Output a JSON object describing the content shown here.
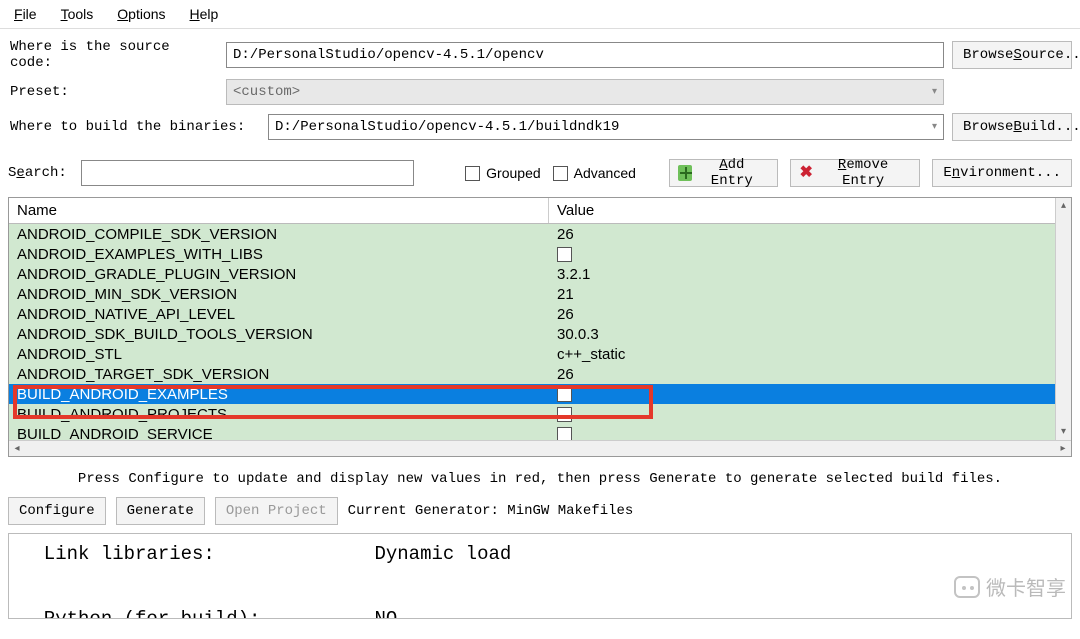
{
  "menu": {
    "file": "File",
    "tools": "Tools",
    "options": "Options",
    "help": "Help"
  },
  "labels": {
    "source": "Where is the source code:",
    "preset": "Preset:",
    "build": "Where to build the binaries:",
    "search": "Search:",
    "grouped": "Grouped",
    "advanced": "Advanced"
  },
  "paths": {
    "source": "D:/PersonalStudio/opencv-4.5.1/opencv",
    "preset": "<custom>",
    "build": "D:/PersonalStudio/opencv-4.5.1/buildndk19"
  },
  "buttons": {
    "browse_source": "Browse Source...",
    "browse_build": "Browse Build...",
    "add_entry": "Add Entry",
    "remove_entry": "Remove Entry",
    "environment": "Environment...",
    "configure": "Configure",
    "generate": "Generate",
    "open_project": "Open Project"
  },
  "columns": {
    "name": "Name",
    "value": "Value"
  },
  "rows": [
    {
      "name": "ANDROID_COMPILE_SDK_VERSION",
      "value": "26"
    },
    {
      "name": "ANDROID_EXAMPLES_WITH_LIBS",
      "value": "",
      "checkbox": true
    },
    {
      "name": "ANDROID_GRADLE_PLUGIN_VERSION",
      "value": "3.2.1"
    },
    {
      "name": "ANDROID_MIN_SDK_VERSION",
      "value": "21"
    },
    {
      "name": "ANDROID_NATIVE_API_LEVEL",
      "value": "26"
    },
    {
      "name": "ANDROID_SDK_BUILD_TOOLS_VERSION",
      "value": "30.0.3"
    },
    {
      "name": "ANDROID_STL",
      "value": "c++_static"
    },
    {
      "name": "ANDROID_TARGET_SDK_VERSION",
      "value": "26"
    },
    {
      "name": "BUILD_ANDROID_EXAMPLES",
      "value": "",
      "checkbox": true,
      "selected": true
    },
    {
      "name": "BUILD_ANDROID_PROJECTS",
      "value": "",
      "checkbox": true
    },
    {
      "name": "BUILD_ANDROID_SERVICE",
      "value": "",
      "checkbox": true
    }
  ],
  "hint": "Press Configure to update and display new values in red, then press Generate to generate selected build files.",
  "generator_label": "Current Generator: MinGW Makefiles",
  "output_lines": "  Link libraries:              Dynamic load\n\n  Python (for build):          NO",
  "watermark": "微卡智享"
}
